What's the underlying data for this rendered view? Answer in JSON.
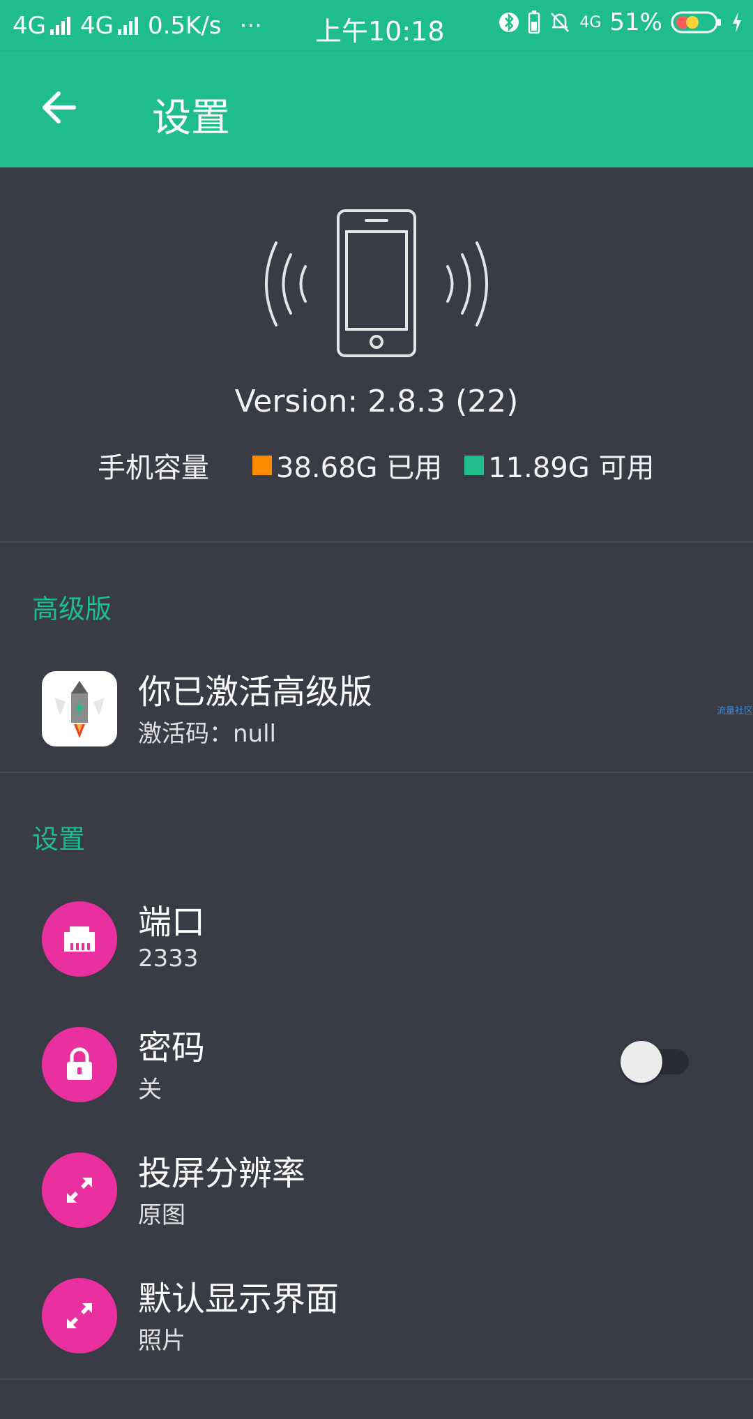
{
  "status_bar": {
    "network_1": "4G",
    "network_2": "4G",
    "speed": "0.5K/s",
    "more": "···",
    "time": "上午10:18",
    "net_type": "4G",
    "battery": "51%"
  },
  "app_bar": {
    "title": "设置"
  },
  "hero": {
    "version": "Version: 2.8.3 (22)",
    "storage_label": "手机容量",
    "used_value": "38.68G 已用",
    "free_value": "11.89G 可用",
    "used_color": "#ff8c00",
    "free_color": "#1fbd8c"
  },
  "premium_section": {
    "header": "高级版",
    "item": {
      "title": "你已激活高级版",
      "subtitle": "激活码：null"
    },
    "watermark": "流量社区"
  },
  "settings_section": {
    "header": "设置",
    "items": [
      {
        "title": "端口",
        "subtitle": "2333",
        "icon": "ethernet-port-icon"
      },
      {
        "title": "密码",
        "subtitle": "关",
        "icon": "lock-icon",
        "toggle_on": false
      },
      {
        "title": "投屏分辨率",
        "subtitle": "原图",
        "icon": "expand-arrows-icon"
      },
      {
        "title": "默认显示界面",
        "subtitle": "照片",
        "icon": "expand-arrows-icon"
      }
    ]
  },
  "colors": {
    "accent": "#1fbd8c",
    "background": "#393b45",
    "icon_bg": "#ea2f9f"
  }
}
